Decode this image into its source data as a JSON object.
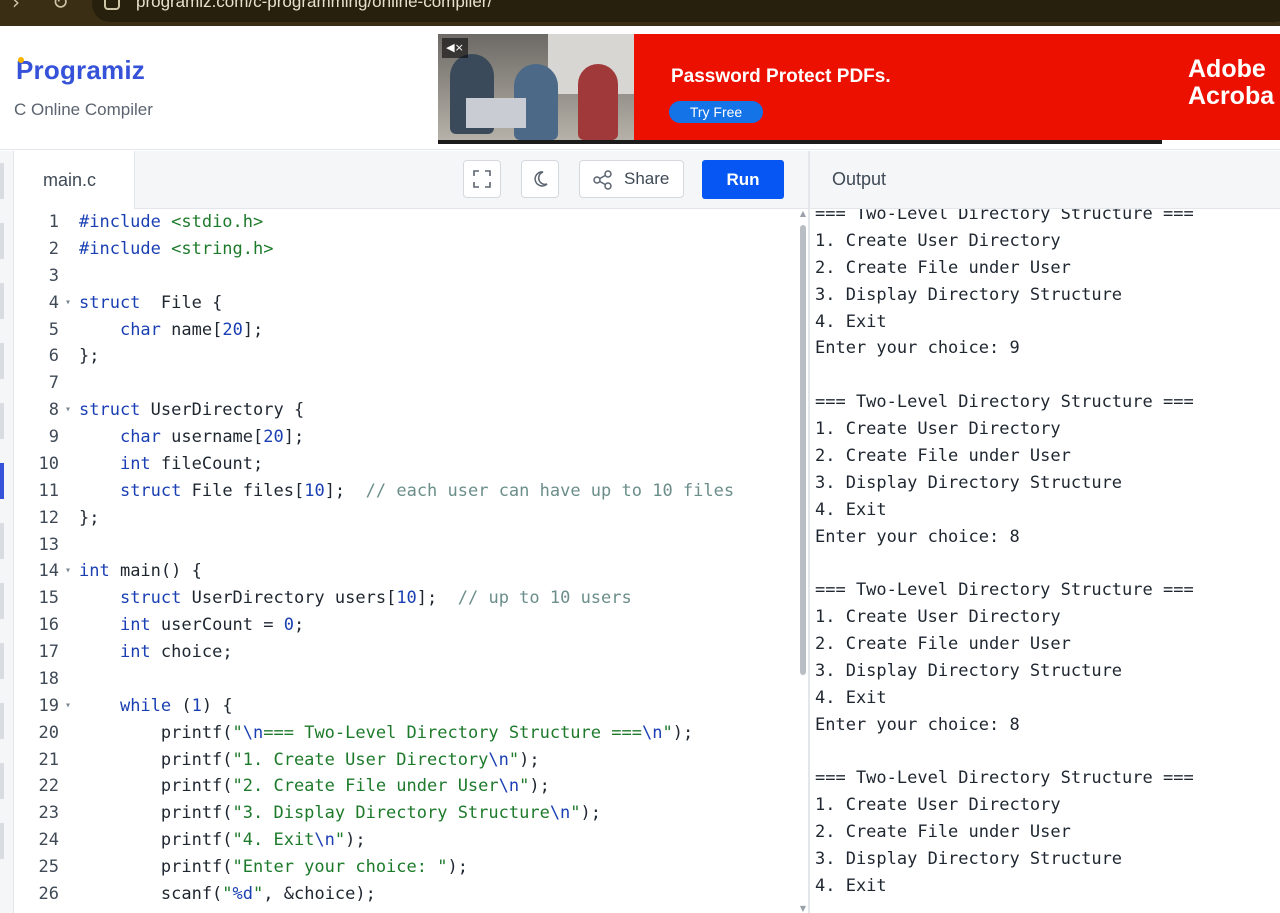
{
  "browser": {
    "url": "programiz.com/c-programming/online-compiler/"
  },
  "header": {
    "logo": "Programiz",
    "subtitle": "C Online Compiler"
  },
  "ad": {
    "headline": "Password Protect PDFs.",
    "cta": "Try Free",
    "brand_line1": "Adobe",
    "brand_line2": "Acroba",
    "progress": 0.86,
    "mute_label": "◀×"
  },
  "editor": {
    "file_tab": "main.c",
    "share_label": "Share",
    "run_label": "Run",
    "line_numbers": [
      "1",
      "2",
      "3",
      "4",
      "5",
      "6",
      "7",
      "8",
      "9",
      "10",
      "11",
      "12",
      "13",
      "14",
      "15",
      "16",
      "17",
      "18",
      "19",
      "20",
      "21",
      "22",
      "23",
      "24",
      "25",
      "26"
    ],
    "fold_lines": [
      4,
      8,
      14,
      19
    ],
    "lines": [
      [
        [
          "kw",
          "#include "
        ],
        [
          "str",
          "<stdio.h>"
        ]
      ],
      [
        [
          "kw",
          "#include "
        ],
        [
          "str",
          "<string.h>"
        ]
      ],
      [],
      [
        [
          "kw",
          "struct"
        ],
        [
          "",
          "  File {"
        ]
      ],
      [
        [
          "",
          "    "
        ],
        [
          "kw",
          "char"
        ],
        [
          "",
          " name["
        ],
        [
          "num",
          "20"
        ],
        [
          "",
          "];"
        ]
      ],
      [
        [
          "",
          "};"
        ]
      ],
      [],
      [
        [
          "kw",
          "struct"
        ],
        [
          "",
          " UserDirectory {"
        ]
      ],
      [
        [
          "",
          "    "
        ],
        [
          "kw",
          "char"
        ],
        [
          "",
          " username["
        ],
        [
          "num",
          "20"
        ],
        [
          "",
          "];"
        ]
      ],
      [
        [
          "",
          "    "
        ],
        [
          "kw",
          "int"
        ],
        [
          "",
          " fileCount;"
        ]
      ],
      [
        [
          "",
          "    "
        ],
        [
          "kw",
          "struct"
        ],
        [
          "",
          " File files["
        ],
        [
          "num",
          "10"
        ],
        [
          "",
          "];  "
        ],
        [
          "cm",
          "// each user can have up to 10 files"
        ]
      ],
      [
        [
          "",
          "};"
        ]
      ],
      [],
      [
        [
          "kw",
          "int"
        ],
        [
          "",
          " main() {"
        ]
      ],
      [
        [
          "",
          "    "
        ],
        [
          "kw",
          "struct"
        ],
        [
          "",
          " UserDirectory users["
        ],
        [
          "num",
          "10"
        ],
        [
          "",
          "];  "
        ],
        [
          "cm",
          "// up to 10 users"
        ]
      ],
      [
        [
          "",
          "    "
        ],
        [
          "kw",
          "int"
        ],
        [
          "",
          " userCount = "
        ],
        [
          "num",
          "0"
        ],
        [
          "",
          ";"
        ]
      ],
      [
        [
          "",
          "    "
        ],
        [
          "kw",
          "int"
        ],
        [
          "",
          " choice;"
        ]
      ],
      [],
      [
        [
          "",
          "    "
        ],
        [
          "kw",
          "while"
        ],
        [
          "",
          " ("
        ],
        [
          "num",
          "1"
        ],
        [
          "",
          ") {"
        ]
      ],
      [
        [
          "",
          "        printf("
        ],
        [
          "str",
          "\""
        ],
        [
          "esc",
          "\\n"
        ],
        [
          "str",
          "=== Two-Level Directory Structure ==="
        ],
        [
          "esc",
          "\\n"
        ],
        [
          "str",
          "\""
        ],
        [
          "",
          ");"
        ]
      ],
      [
        [
          "",
          "        printf("
        ],
        [
          "str",
          "\"1. Create User Directory"
        ],
        [
          "esc",
          "\\n"
        ],
        [
          "str",
          "\""
        ],
        [
          "",
          ");"
        ]
      ],
      [
        [
          "",
          "        printf("
        ],
        [
          "str",
          "\"2. Create File under User"
        ],
        [
          "esc",
          "\\n"
        ],
        [
          "str",
          "\""
        ],
        [
          "",
          ");"
        ]
      ],
      [
        [
          "",
          "        printf("
        ],
        [
          "str",
          "\"3. Display Directory Structure"
        ],
        [
          "esc",
          "\\n"
        ],
        [
          "str",
          "\""
        ],
        [
          "",
          ");"
        ]
      ],
      [
        [
          "",
          "        printf("
        ],
        [
          "str",
          "\"4. Exit"
        ],
        [
          "esc",
          "\\n"
        ],
        [
          "str",
          "\""
        ],
        [
          "",
          ");"
        ]
      ],
      [
        [
          "",
          "        printf("
        ],
        [
          "str",
          "\"Enter your choice: \""
        ],
        [
          "",
          ");"
        ]
      ],
      [
        [
          "",
          "        scanf("
        ],
        [
          "str",
          "\""
        ],
        [
          "esc",
          "%d"
        ],
        [
          "str",
          "\""
        ],
        [
          "",
          ", &choice);"
        ]
      ]
    ]
  },
  "output": {
    "title": "Output",
    "lines": [
      "=== Two-Level Directory Structure ===",
      "1. Create User Directory",
      "2. Create File under User",
      "3. Display Directory Structure",
      "4. Exit",
      "Enter your choice: 9",
      "",
      "=== Two-Level Directory Structure ===",
      "1. Create User Directory",
      "2. Create File under User",
      "3. Display Directory Structure",
      "4. Exit",
      "Enter your choice: 8",
      "",
      "=== Two-Level Directory Structure ===",
      "1. Create User Directory",
      "2. Create File under User",
      "3. Display Directory Structure",
      "4. Exit",
      "Enter your choice: 8",
      "",
      "=== Two-Level Directory Structure ===",
      "1. Create User Directory",
      "2. Create File under User",
      "3. Display Directory Structure",
      "4. Exit"
    ]
  },
  "colors": {
    "brand": "#3552d8",
    "run_button": "#0556f3",
    "ad_red": "#eb1000",
    "ad_cta": "#1473e6"
  },
  "icons": [
    "back-arrow-icon",
    "reload-icon",
    "site-info-icon",
    "mute-icon",
    "fullscreen-icon",
    "dark-mode-icon",
    "share-icon",
    "fold-arrow-icon"
  ]
}
